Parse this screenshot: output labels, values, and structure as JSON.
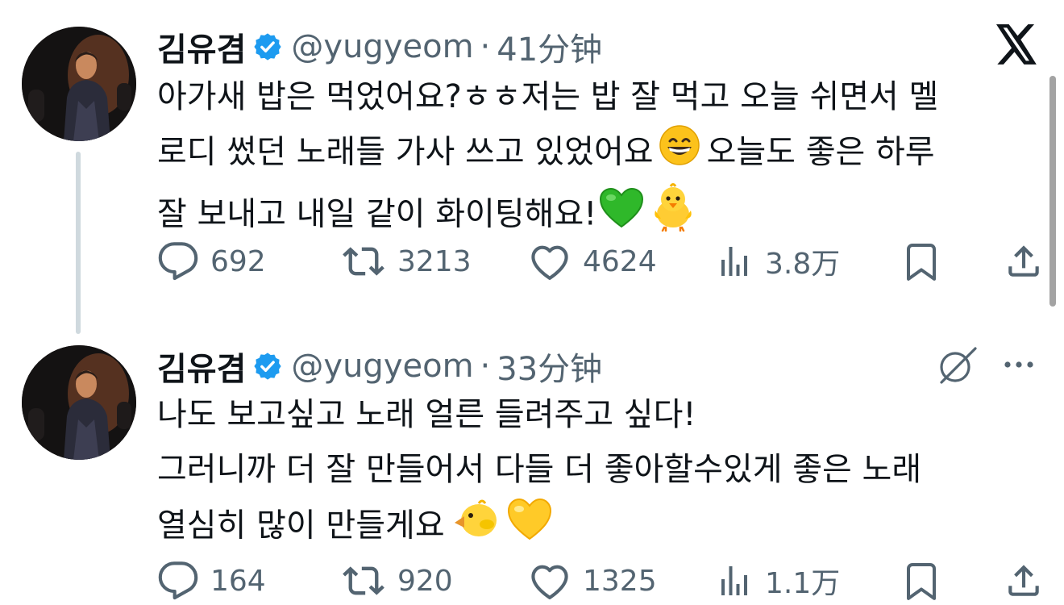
{
  "tweets": [
    {
      "author": {
        "display_name": "김유겸",
        "handle": "@yugyeom",
        "verified": true
      },
      "separator": "·",
      "time": "41分钟",
      "text_lines": [
        "아가새 밥은 먹었어요?ㅎㅎ저는 밥 잘 먹고 오늘 쉬면서 멜",
        "로디 썼던 노래들 가사 쓰고 있었어요",
        "오늘도 좋은 하루",
        "잘 보내고 내일 같이 화이팅해요!"
      ],
      "emojis": [
        "grinning-face",
        "green-heart",
        "front-facing-baby-chick"
      ],
      "metrics": {
        "replies": "692",
        "reposts": "3213",
        "likes": "4624",
        "views": "3.8万"
      }
    },
    {
      "author": {
        "display_name": "김유겸",
        "handle": "@yugyeom",
        "verified": true
      },
      "separator": "·",
      "time": "33分钟",
      "text_lines": [
        "나도 보고싶고 노래 얼른 들려주고 싶다!",
        "그러니까 더 잘 만들어서 다들 더 좋아할수있게 좋은 노래",
        "열심히 많이 만들게요"
      ],
      "emojis": [
        "baby-chick",
        "yellow-heart"
      ],
      "metrics": {
        "replies": "164",
        "reposts": "920",
        "likes": "1325",
        "views": "1.1万"
      }
    }
  ],
  "icons": {
    "logo": "x-logo-icon",
    "grok": "grok-icon",
    "more": "more-icon",
    "reply": "reply-icon",
    "repost": "repost-icon",
    "like": "heart-icon",
    "views": "views-icon",
    "bookmark": "bookmark-icon",
    "share": "share-icon"
  },
  "colors": {
    "text": "#0f1419",
    "secondary": "#536471",
    "verified": "#1d9bf0",
    "thread_line": "#cfd9de"
  }
}
